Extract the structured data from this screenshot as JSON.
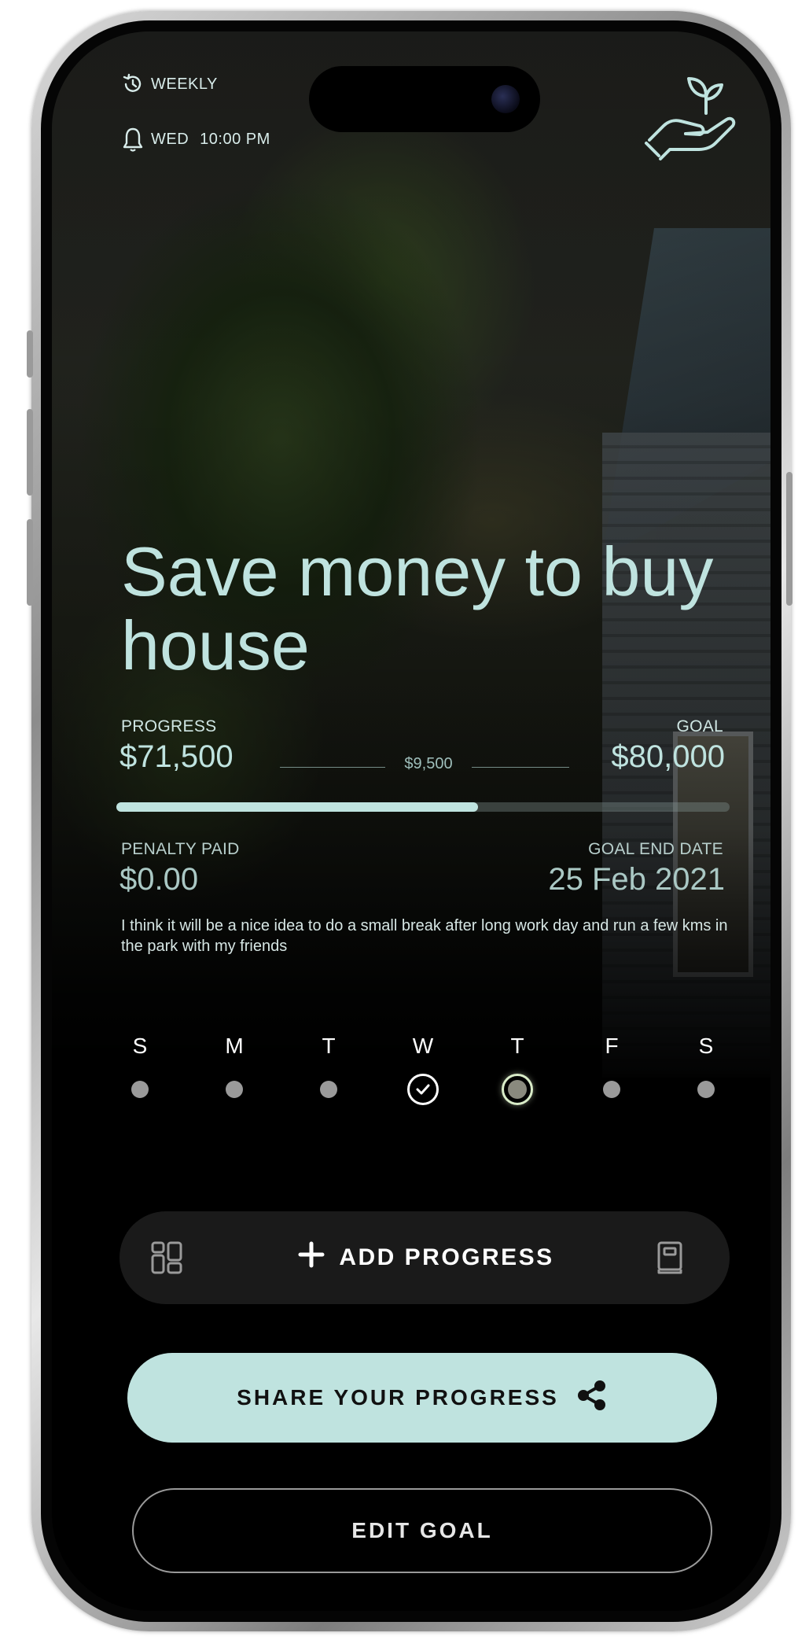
{
  "header": {
    "frequency_label": "WEEKLY",
    "reminder_day": "WED",
    "reminder_time": "10:00 PM"
  },
  "goal": {
    "title": "Save money to buy house",
    "progress_label": "PROGRESS",
    "progress_value": "$71,500",
    "remaining_value": "$9,500",
    "goal_label": "GOAL",
    "goal_value": "$80,000",
    "progress_fraction": 0.59,
    "penalty_label": "PENALTY PAID",
    "penalty_value": "$0.00",
    "end_date_label": "GOAL END DATE",
    "end_date_value": "25 Feb 2021",
    "note": "I think it will be a nice idea to do a small break after long work day and run a few kms in the park with my friends"
  },
  "week": {
    "days": [
      {
        "letter": "S",
        "status": "none"
      },
      {
        "letter": "M",
        "status": "none"
      },
      {
        "letter": "T",
        "status": "none"
      },
      {
        "letter": "W",
        "status": "done"
      },
      {
        "letter": "T",
        "status": "today"
      },
      {
        "letter": "F",
        "status": "none"
      },
      {
        "letter": "S",
        "status": "none"
      }
    ]
  },
  "actions": {
    "add_progress_label": "ADD PROGRESS",
    "share_label": "SHARE YOUR PROGRESS",
    "edit_label": "EDIT GOAL"
  },
  "icons": {
    "frequency": "history-icon",
    "reminder": "bell-icon",
    "brand": "plant-in-hand-icon",
    "left_action": "dashboard-icon",
    "right_action": "journal-icon",
    "add": "plus-icon",
    "share": "share-icon",
    "done_day": "check-circle-icon"
  },
  "colors": {
    "accent": "#bfe3df",
    "background": "#000000",
    "bar": "#1a1a1a"
  }
}
